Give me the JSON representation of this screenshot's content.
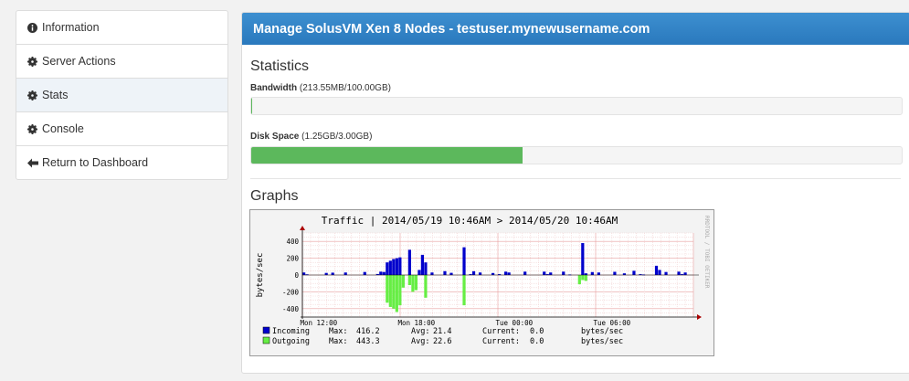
{
  "sidebar": {
    "items": [
      {
        "label": "Information",
        "icon": "info-circle-icon"
      },
      {
        "label": "Server Actions",
        "icon": "gear-icon"
      },
      {
        "label": "Stats",
        "icon": "gear-icon",
        "active": true
      },
      {
        "label": "Console",
        "icon": "gear-icon"
      },
      {
        "label": "Return to Dashboard",
        "icon": "arrow-left-icon"
      }
    ]
  },
  "panel": {
    "title": "Manage SolusVM Xen 8 Nodes - testuser.mynewusername.com",
    "statistics_heading": "Statistics",
    "bandwidth": {
      "label": "Bandwidth",
      "value_text": "(213.55MB/100.00GB)",
      "fraction": 0.0021
    },
    "disk": {
      "label": "Disk Space",
      "value_text": "(1.25GB/3.00GB)",
      "fraction": 0.4167
    },
    "graphs_heading": "Graphs"
  },
  "colors": {
    "accent": "#2f80c5",
    "progress": "#5cb85c",
    "incoming": "#0000cc",
    "outgoing": "#66ee44"
  },
  "chart_data": {
    "type": "bar",
    "title": "Traffic | 2014/05/19 10:46AM > 2014/05/20 10:46AM",
    "ylabel": "bytes/sec",
    "watermark": "RRDTOOL / TOBI OETIKER",
    "ylim": [
      -500,
      500
    ],
    "yticks": [
      400,
      200,
      0,
      -200,
      -400
    ],
    "xticks": [
      "Mon 12:00",
      "Mon 18:00",
      "Tue 00:00",
      "Tue 06:00"
    ],
    "grid": true,
    "series": [
      {
        "name": "Incoming",
        "color": "#0000cc",
        "values": [
          30,
          8,
          0,
          0,
          0,
          0,
          0,
          25,
          0,
          28,
          0,
          0,
          0,
          30,
          0,
          0,
          0,
          0,
          0,
          36,
          0,
          0,
          0,
          12,
          40,
          36,
          150,
          170,
          190,
          200,
          210,
          0,
          0,
          300,
          0,
          0,
          60,
          240,
          150,
          0,
          30,
          0,
          0,
          0,
          46,
          0,
          26,
          0,
          0,
          0,
          330,
          0,
          10,
          45,
          0,
          30,
          0,
          0,
          0,
          24,
          0,
          10,
          0,
          40,
          30,
          0,
          0,
          0,
          0,
          40,
          0,
          0,
          0,
          0,
          0,
          40,
          10,
          30,
          0,
          0,
          0,
          40,
          0,
          6,
          0,
          0,
          0,
          380,
          20,
          0,
          35,
          0,
          30,
          0,
          0,
          0,
          0,
          38,
          0,
          0,
          20,
          0,
          0,
          50,
          0,
          10,
          6,
          0,
          0,
          0,
          110,
          60,
          0,
          36,
          0,
          0,
          0,
          40,
          10,
          30,
          0,
          0
        ],
        "legend": {
          "max": "416.2",
          "avg": "21.4",
          "current": "0.0",
          "unit": "bytes/sec"
        }
      },
      {
        "name": "Outgoing",
        "color": "#66ee44",
        "values": [
          0,
          0,
          0,
          0,
          0,
          0,
          0,
          0,
          0,
          0,
          0,
          0,
          0,
          0,
          0,
          0,
          0,
          0,
          0,
          0,
          0,
          0,
          0,
          0,
          0,
          0,
          -330,
          -380,
          -400,
          -440,
          -360,
          -150,
          0,
          -120,
          -200,
          -180,
          0,
          0,
          -270,
          0,
          0,
          0,
          0,
          0,
          0,
          0,
          0,
          0,
          0,
          0,
          -360,
          0,
          0,
          0,
          0,
          0,
          0,
          0,
          0,
          0,
          0,
          0,
          0,
          0,
          0,
          0,
          0,
          0,
          0,
          0,
          0,
          0,
          0,
          0,
          0,
          0,
          0,
          0,
          0,
          0,
          0,
          0,
          0,
          0,
          0,
          0,
          -110,
          -60,
          -70,
          0,
          0,
          0,
          0,
          0,
          0,
          0,
          0,
          0,
          0,
          0,
          0,
          0,
          0,
          0,
          0,
          0,
          0,
          0,
          0,
          0,
          0,
          0,
          0,
          0,
          0,
          0,
          0,
          0,
          0,
          0,
          0,
          0
        ],
        "legend": {
          "max": "443.3",
          "avg": "22.6",
          "current": "0.0",
          "unit": "bytes/sec"
        }
      }
    ],
    "legend_labels": {
      "max": "Max:",
      "avg": "Avg:",
      "current": "Current:"
    }
  }
}
